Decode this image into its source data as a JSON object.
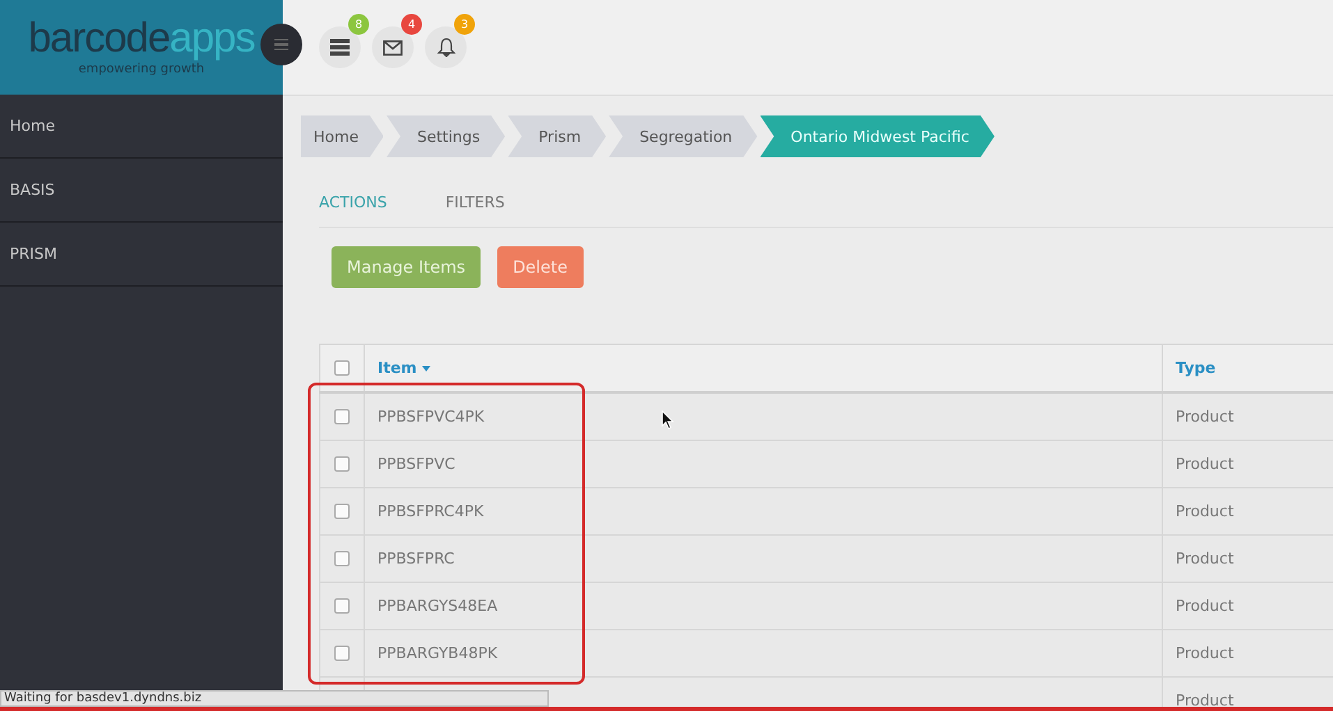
{
  "logo": {
    "word_dark": "barcode",
    "word_light": "apps",
    "tagline": "empowering growth"
  },
  "header_icons": [
    {
      "kind": "stack",
      "badge": "8",
      "color": "#8cc63f"
    },
    {
      "kind": "mail",
      "badge": "4",
      "color": "#e8473f"
    },
    {
      "kind": "bell",
      "badge": "3",
      "color": "#f0a30a"
    }
  ],
  "sidebar": {
    "items": [
      {
        "label": "Home"
      },
      {
        "label": "BASIS"
      },
      {
        "label": "PRISM"
      }
    ]
  },
  "breadcrumbs": [
    {
      "label": "Home",
      "selected": false
    },
    {
      "label": "Settings",
      "selected": false
    },
    {
      "label": "Prism",
      "selected": false
    },
    {
      "label": "Segregation",
      "selected": false
    },
    {
      "label": "Ontario Midwest Pacific",
      "selected": true
    }
  ],
  "tabs": [
    {
      "label": "ACTIONS",
      "selected": true
    },
    {
      "label": "FILTERS",
      "selected": false
    }
  ],
  "buttons": [
    {
      "label": "Manage Items",
      "kind": "primary"
    },
    {
      "label": "Delete",
      "kind": "danger"
    }
  ],
  "table": {
    "header_checked": false,
    "columns": [
      {
        "label": "Item",
        "sorted": true
      },
      {
        "label": "Type",
        "sorted": false
      }
    ],
    "rows": [
      {
        "checked": false,
        "item": "PPBSFPVC4PK",
        "type": "Product"
      },
      {
        "checked": false,
        "item": "PPBSFPVC",
        "type": "Product"
      },
      {
        "checked": false,
        "item": "PPBSFPRC4PK",
        "type": "Product"
      },
      {
        "checked": false,
        "item": "PPBSFPRC",
        "type": "Product"
      },
      {
        "checked": false,
        "item": "PPBARGYS48EA",
        "type": "Product"
      },
      {
        "checked": false,
        "item": "PPBARGYB48PK",
        "type": "Product"
      },
      {
        "type": "Product"
      }
    ]
  },
  "status_bar": {
    "text": "Waiting for basdev1.dyndns.biz"
  }
}
